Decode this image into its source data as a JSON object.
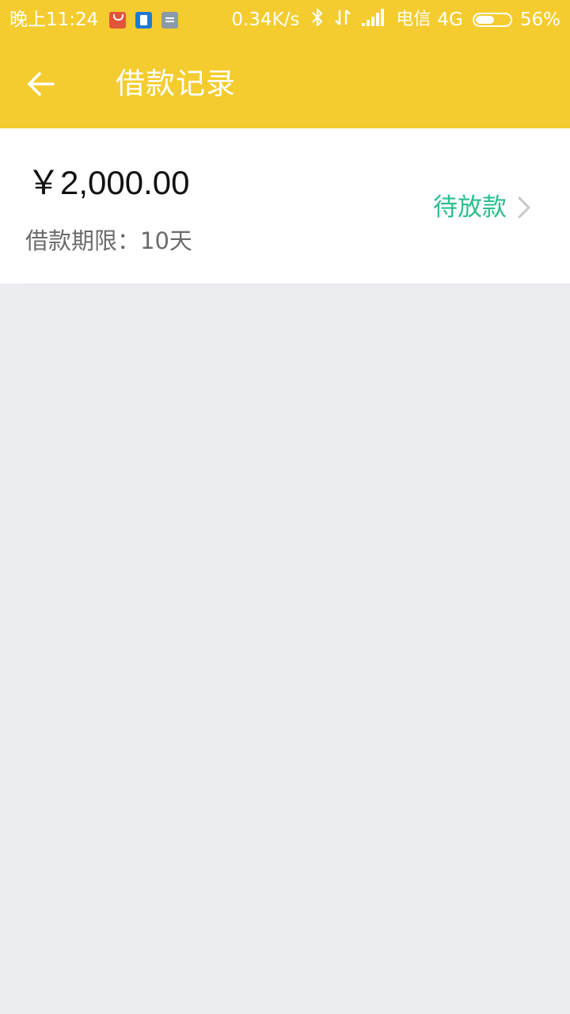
{
  "status_bar": {
    "time": "晚上11:24",
    "notifications": [
      "shop-bag-icon",
      "document-icon",
      "message-icon"
    ],
    "net_speed": "0.34K/s",
    "carrier": "电信",
    "network": "4G",
    "battery_percent": "56%",
    "battery_level": 0.56
  },
  "header": {
    "title": "借款记录",
    "back_icon": "arrow-left-icon",
    "bg_color": "#f4cc2f"
  },
  "record": {
    "amount": "￥2,000.00",
    "term_label": "借款期限：",
    "term_value": "10天",
    "status": "待放款",
    "status_color": "#2bbf8a",
    "chevron_icon": "chevron-right-icon"
  }
}
